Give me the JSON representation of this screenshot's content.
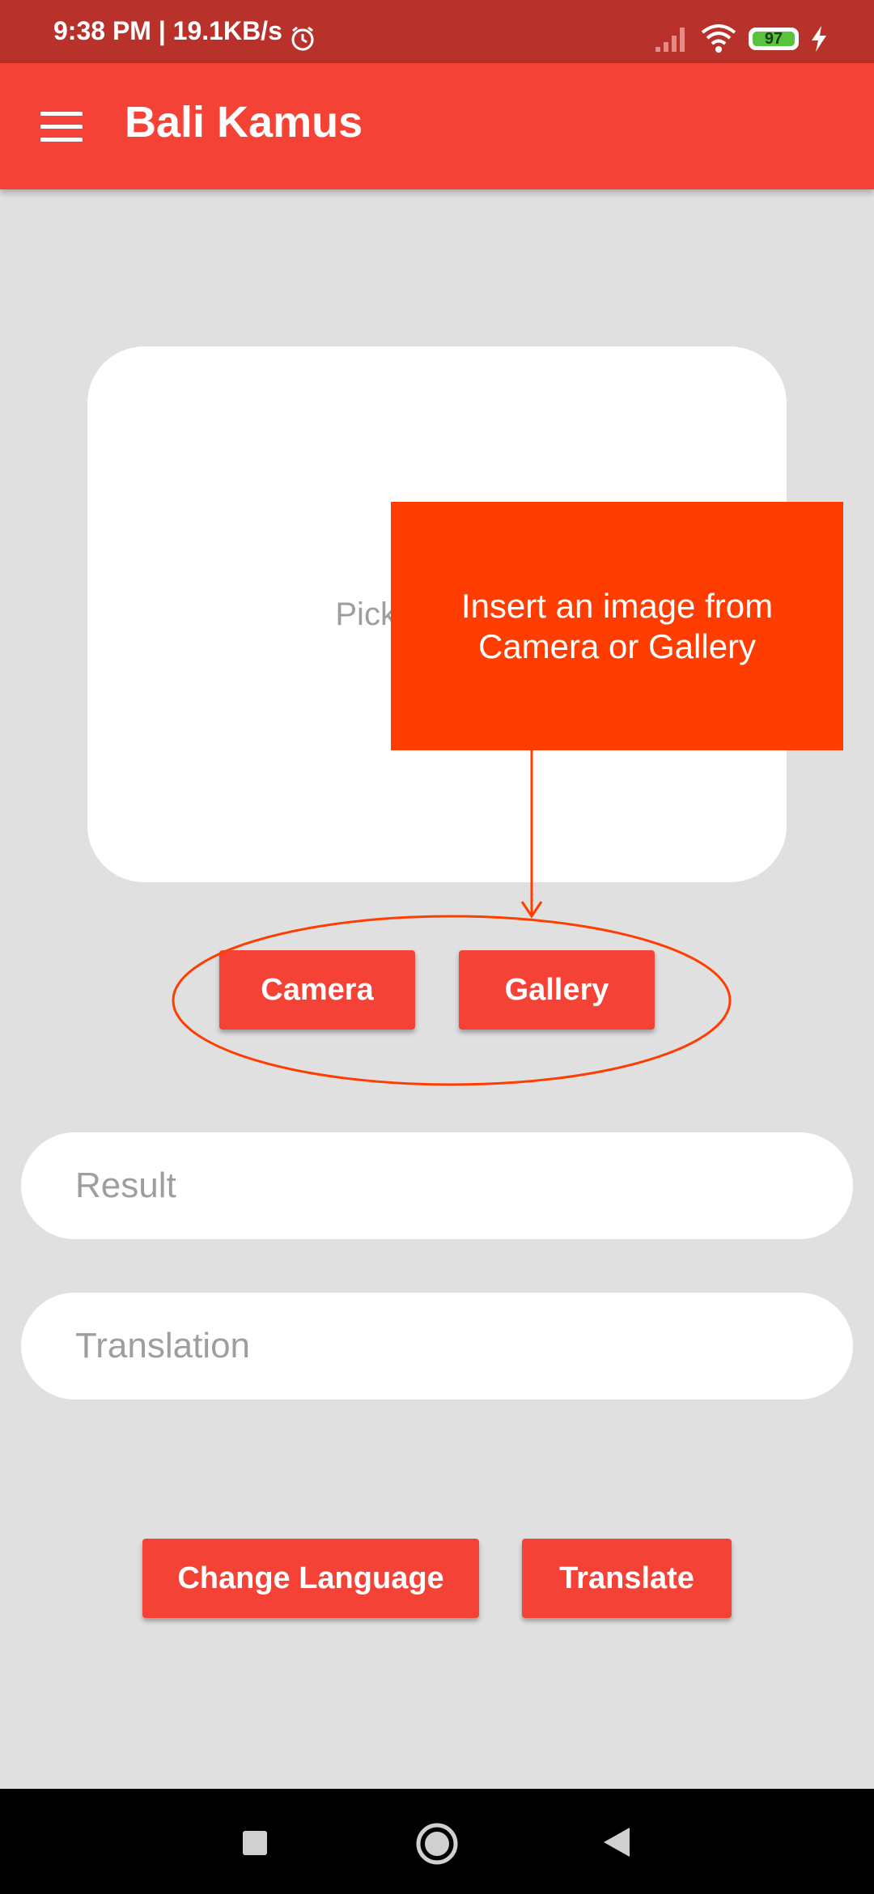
{
  "status_bar": {
    "time_speed": "9:38 PM | 19.1KB/s",
    "battery_level": "97"
  },
  "app_bar": {
    "title": "Bali Kamus"
  },
  "image_area": {
    "placeholder": "Pick an image"
  },
  "image_buttons": {
    "camera_label": "Camera",
    "gallery_label": "Gallery"
  },
  "fields": {
    "result_placeholder": "Result",
    "translation_placeholder": "Translation"
  },
  "bottom_buttons": {
    "change_language_label": "Change Language",
    "translate_label": "Translate"
  },
  "tooltip": {
    "text": "Insert an image from Camera or Gallery"
  },
  "colors": {
    "primary": "#f44336",
    "status_bar": "#b8312b",
    "tooltip": "#ff3d00",
    "background": "#e0e0e0"
  }
}
